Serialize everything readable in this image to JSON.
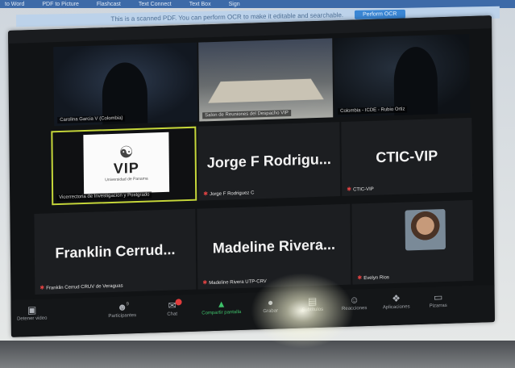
{
  "topbar": {
    "items": [
      "to Word",
      "PDF to Picture",
      "Flashcast",
      "Text Connect",
      "Text Box",
      "Sign"
    ]
  },
  "ocr_bar": {
    "message": "This is a scanned PDF. You can perform OCR to make it editable and searchable.",
    "button": "Perform OCR"
  },
  "zoom": {
    "window_title": "",
    "tiles": [
      {
        "name": "Carolina Garcia V (Colombia)"
      },
      {
        "name": "Salon de Reuniones del Despacho VIP"
      },
      {
        "name": "Colombia - ICDE - Rubio Ortiz"
      },
      {
        "name": "Vicerrectoria de Investigacion y Postgrado",
        "logo_text": "VIP",
        "logo_sub": "Universidad de Panama"
      },
      {
        "big": "Jorge F Rodrigu...",
        "name": "Jorge F Rodriguez C"
      },
      {
        "big": "CTIC-VIP",
        "name": "CTIC-VIP"
      },
      {
        "big": "Franklin Cerrud...",
        "name": "Franklin Cerrud CRUV de Veraguas"
      },
      {
        "big": "Madeline Rivera...",
        "name": "Madeline Rivera UTP-CRV"
      },
      {
        "name": "Evelyn Rios"
      }
    ],
    "toolbar": {
      "stop_video": "Detener video",
      "participants": "Participantes",
      "participants_count": "9",
      "chat": "Chat",
      "share": "Compartir pantalla",
      "record": "Grabar",
      "reactions": "Reacciones",
      "apps": "Aplicaciones",
      "whiteboard": "Pizarras",
      "more": "Subtítulos"
    }
  }
}
